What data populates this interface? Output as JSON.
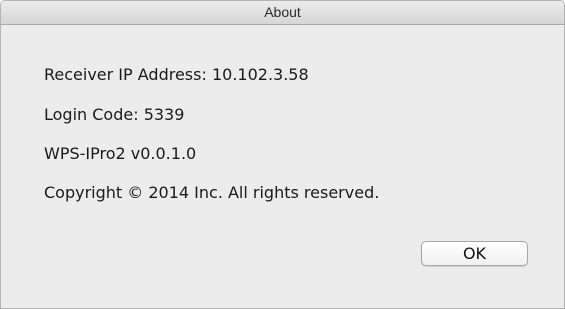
{
  "window": {
    "title": "About"
  },
  "info": {
    "receiver_ip": "Receiver IP Address: 10.102.3.58",
    "login_code": "Login Code: 5339",
    "version": "WPS-IPro2 v0.0.1.0",
    "copyright": "Copyright © 2014 Inc. All rights reserved."
  },
  "buttons": {
    "ok_label": "OK"
  }
}
